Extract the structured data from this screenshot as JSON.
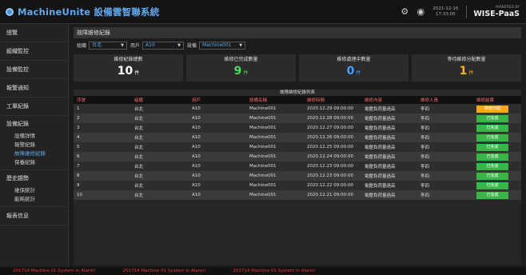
{
  "app": {
    "title": "MachineUnite 設備雲智聯系統"
  },
  "header": {
    "datetime_date": "2021-12-16",
    "datetime_time": "17:33:00",
    "powered_by": "POWERED BY",
    "brand": "WISE-PaaS",
    "icons": [
      "settings-icon",
      "user-icon"
    ]
  },
  "sidebar": {
    "items": [
      {
        "label": "總覽"
      },
      {
        "label": "組織監控"
      },
      {
        "label": "設備監控"
      },
      {
        "label": "報警通知"
      },
      {
        "label": "工單紀錄"
      }
    ],
    "device_group": {
      "label": "設備紀錄",
      "children": [
        {
          "label": "設備詳情"
        },
        {
          "label": "報警紀錄"
        },
        {
          "label": "故障維修紀錄"
        },
        {
          "label": "保養紀錄"
        }
      ]
    },
    "trend_group": {
      "label": "歷史趨勢",
      "children": [
        {
          "label": "維保統計"
        },
        {
          "label": "能耗統計"
        }
      ]
    },
    "report": {
      "label": "報表信息"
    }
  },
  "page": {
    "title": "故障維修紀錄"
  },
  "filters": {
    "org_label": "組織",
    "org_value": "台北",
    "user_label": "用戶",
    "user_value": "A10",
    "device_label": "設備",
    "device_value": "Machine001"
  },
  "stats": [
    {
      "title": "維修紀錄總數",
      "value": "10",
      "unit": "件",
      "color": "#ffffff"
    },
    {
      "title": "維修已完成數量",
      "value": "9",
      "unit": "件",
      "color": "#4cd964"
    },
    {
      "title": "維修處理中數量",
      "value": "0",
      "unit": "件",
      "color": "#4a9fff"
    },
    {
      "title": "等待維修分配數量",
      "value": "1",
      "unit": "件",
      "color": "#f5b31c"
    }
  ],
  "table": {
    "title": "故障維修紀錄列表",
    "columns": [
      "序號",
      "組織",
      "用戶",
      "設備名稱",
      "維修時間",
      "維修內容",
      "維修人員",
      "維修結果"
    ],
    "rows": [
      {
        "no": "1",
        "org": "台北",
        "user": "A10",
        "device": "Machine001",
        "time": "2020.12.29 09:00:00",
        "content": "電壓負荷量過高",
        "staff": "李四",
        "result": "等待分配",
        "status": "waiting"
      },
      {
        "no": "2",
        "org": "台北",
        "user": "A10",
        "device": "Machine001",
        "time": "2020.12.28 09:00:00",
        "content": "電壓負荷量過高",
        "staff": "李四",
        "result": "已完成",
        "status": "done"
      },
      {
        "no": "3",
        "org": "台北",
        "user": "A10",
        "device": "Machine001",
        "time": "2020.12.27 09:00:00",
        "content": "電壓負荷量過高",
        "staff": "李四",
        "result": "已完成",
        "status": "done"
      },
      {
        "no": "4",
        "org": "台北",
        "user": "A10",
        "device": "Machine001",
        "time": "2020.12.26 09:00:00",
        "content": "電壓負荷量過高",
        "staff": "李四",
        "result": "已完成",
        "status": "done"
      },
      {
        "no": "5",
        "org": "台北",
        "user": "A10",
        "device": "Machine001",
        "time": "2020.12.25 09:00:00",
        "content": "電壓負荷量過高",
        "staff": "李四",
        "result": "已完成",
        "status": "done"
      },
      {
        "no": "6",
        "org": "台北",
        "user": "A10",
        "device": "Machine001",
        "time": "2020.12.24 09:00:00",
        "content": "電壓負荷量過高",
        "staff": "李四",
        "result": "已完成",
        "status": "done"
      },
      {
        "no": "7",
        "org": "台北",
        "user": "A10",
        "device": "Machine001",
        "time": "2020.12.23 09:00:00",
        "content": "電壓負荷量過高",
        "staff": "李四",
        "result": "已完成",
        "status": "done"
      },
      {
        "no": "8",
        "org": "台北",
        "user": "A10",
        "device": "Machine001",
        "time": "2020.12.23 09:00:00",
        "content": "電壓負荷量過高",
        "staff": "李四",
        "result": "已完成",
        "status": "done"
      },
      {
        "no": "9",
        "org": "台北",
        "user": "A10",
        "device": "Machine001",
        "time": "2020.12.22 09:00:00",
        "content": "電壓負荷量過高",
        "staff": "李四",
        "result": "已完成",
        "status": "done"
      },
      {
        "no": "10",
        "org": "台北",
        "user": "A10",
        "device": "Machine001",
        "time": "2020.12.21 09:00:00",
        "content": "電壓負荷量過高",
        "staff": "李四",
        "result": "已完成",
        "status": "done"
      }
    ]
  },
  "status_colors": {
    "waiting": "#f5a623",
    "done": "#3bb54a"
  },
  "ticker": {
    "messages": [
      "201714 Machine 01 System in Alarm!",
      "201714 Machine 01 System in Alarm!",
      "201714 Machine 01 System in Alarm!"
    ]
  }
}
